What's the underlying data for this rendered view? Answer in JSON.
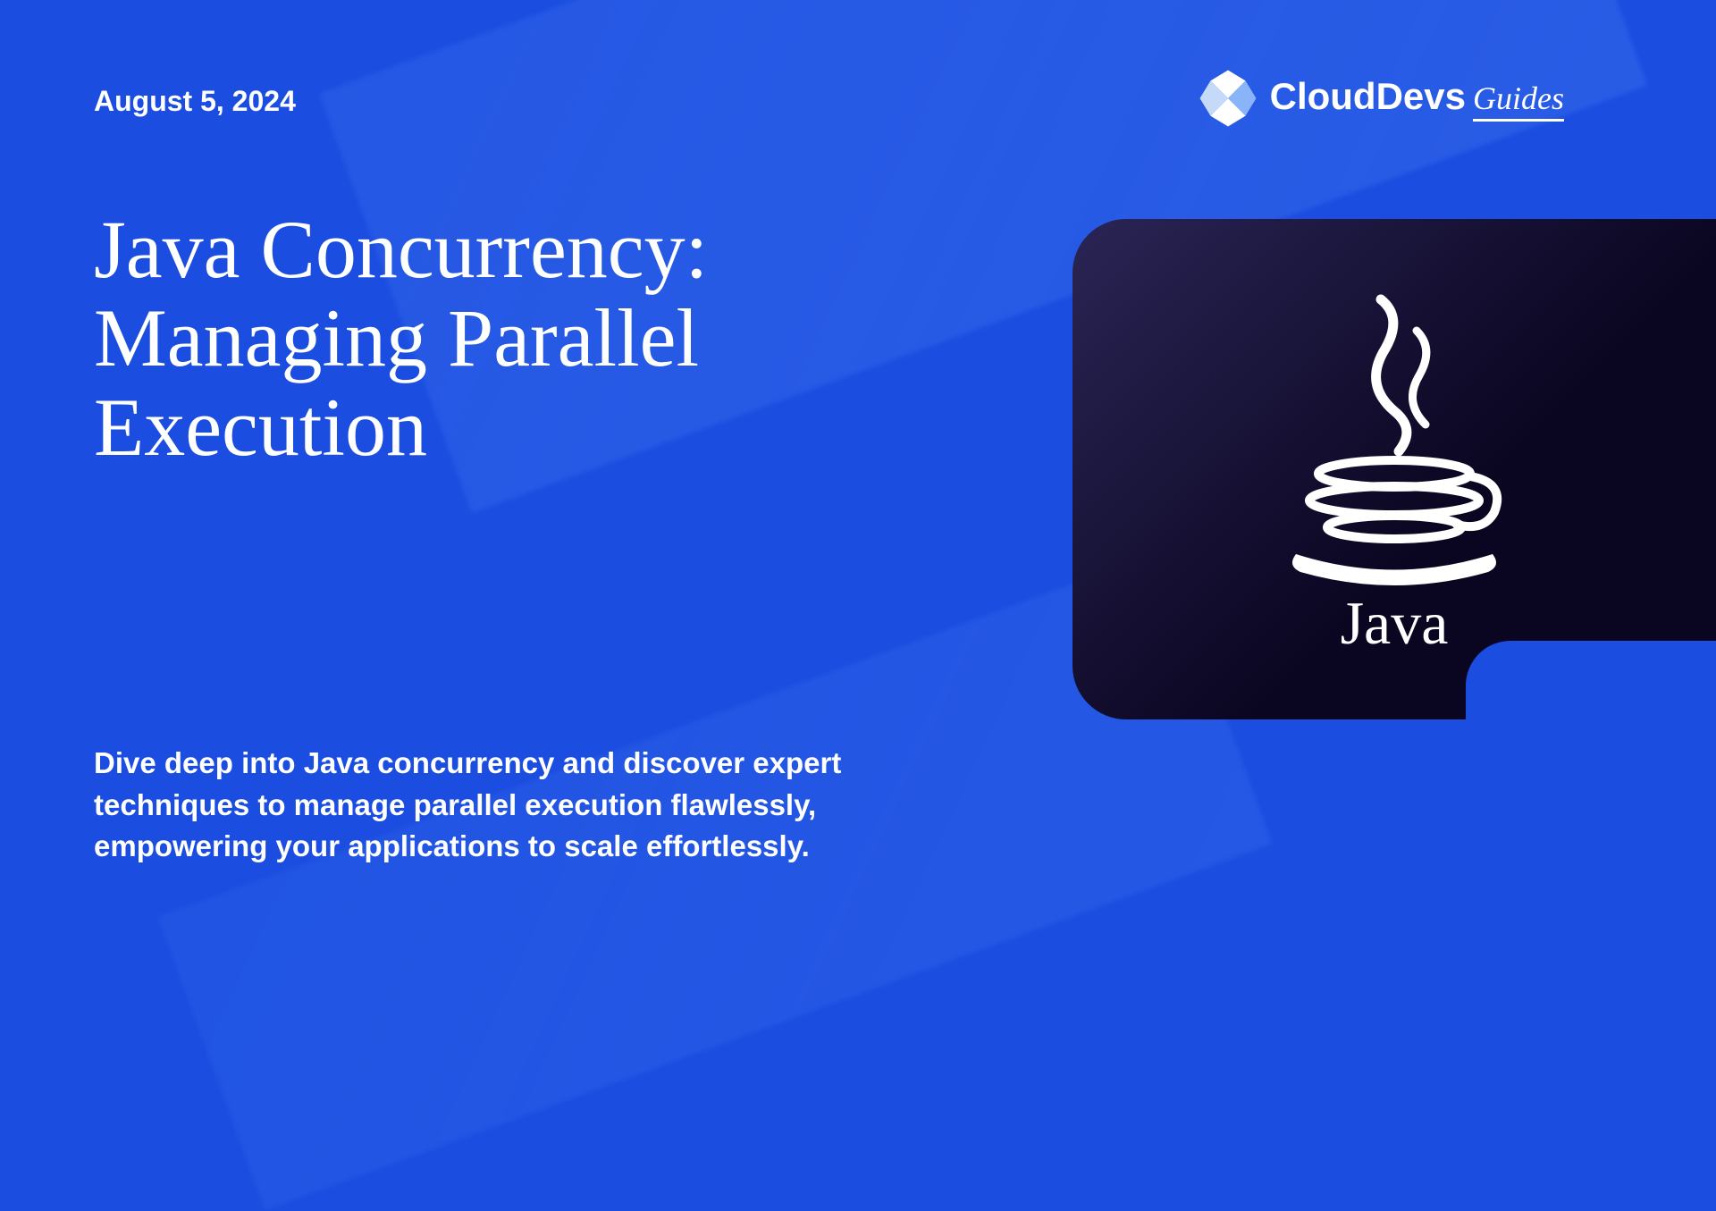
{
  "date": "August 5, 2024",
  "brand": {
    "name": "CloudDevs",
    "suffix": "Guides"
  },
  "title": "Java Concurrency: Managing Parallel Execution",
  "description": "Dive deep into Java concurrency and discover expert techniques to manage parallel execution flawlessly, empowering your applications to scale effortlessly.",
  "tech": {
    "name": "Java"
  }
}
